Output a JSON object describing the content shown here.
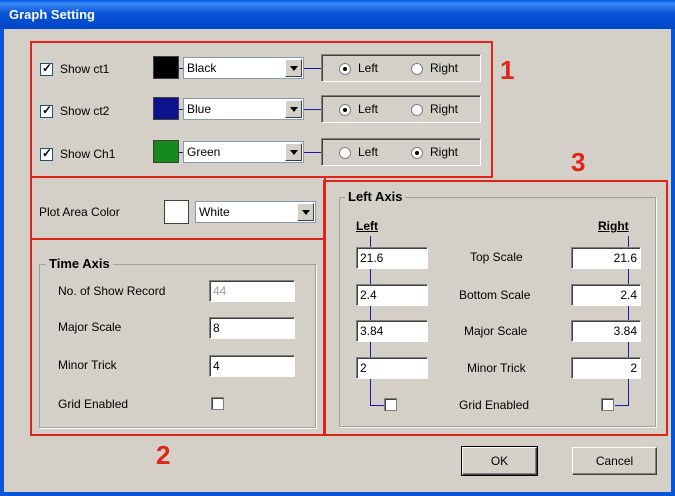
{
  "window": {
    "title": "Graph Setting"
  },
  "series": [
    {
      "show_label": "Show  ct1",
      "checked": true,
      "color_name": "Black",
      "swatch": "#000000",
      "side_left": "Left",
      "side_right": "Right",
      "selected": "Left"
    },
    {
      "show_label": "Show  ct2",
      "checked": true,
      "color_name": "Blue",
      "swatch": "#0c128c",
      "side_left": "Left",
      "side_right": "Right",
      "selected": "Left"
    },
    {
      "show_label": "Show  Ch1",
      "checked": true,
      "color_name": "Green",
      "swatch": "#168a1e",
      "side_left": "Left",
      "side_right": "Right",
      "selected": "Right"
    }
  ],
  "plot_area": {
    "label": "Plot Area Color",
    "color_name": "White",
    "swatch": "#ffffff"
  },
  "time_axis": {
    "title": "Time Axis",
    "show_record_label": "No. of Show Record",
    "show_record_value": "44",
    "major_label": "Major Scale",
    "major_value": "8",
    "minor_label": "Minor Trick",
    "minor_value": "4",
    "grid_label": "Grid Enabled",
    "grid_checked": false
  },
  "left_axis": {
    "title": "Left Axis",
    "left_header": "Left",
    "right_header": "Right",
    "rows": [
      {
        "label": "Top Scale",
        "left": "21.6",
        "right": "21.6"
      },
      {
        "label": "Bottom Scale",
        "left": "2.4",
        "right": "2.4"
      },
      {
        "label": "Major Scale",
        "left": "3.84",
        "right": "3.84"
      },
      {
        "label": "Minor Trick",
        "left": "2",
        "right": "2"
      }
    ],
    "grid_label": "Grid Enabled"
  },
  "annotations": {
    "one": "1",
    "two": "2",
    "three": "3",
    "color": "#e2231a"
  },
  "buttons": {
    "ok": "OK",
    "cancel": "Cancel"
  }
}
